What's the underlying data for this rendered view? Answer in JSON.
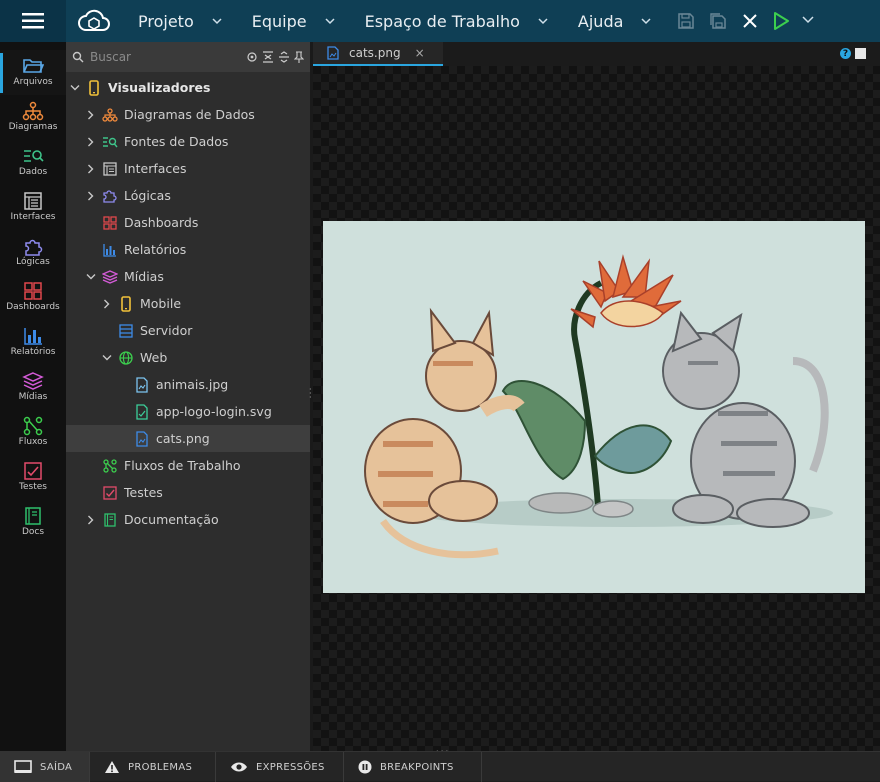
{
  "topbar": {
    "menus": [
      "Projeto",
      "Equipe",
      "Espaço de Trabalho",
      "Ajuda"
    ]
  },
  "activity": [
    {
      "label": "Arquivos",
      "icon": "folder-icon",
      "color": "#5aa7e6"
    },
    {
      "label": "Diagramas",
      "icon": "diagram-icon",
      "color": "#f08a3c"
    },
    {
      "label": "Dados",
      "icon": "data-search-icon",
      "color": "#3ec48a"
    },
    {
      "label": "Interfaces",
      "icon": "interface-icon",
      "color": "#c7c7c7"
    },
    {
      "label": "Lógicas",
      "icon": "puzzle-icon",
      "color": "#8f8cf0"
    },
    {
      "label": "Dashboards",
      "icon": "dashboard-icon",
      "color": "#e0474c"
    },
    {
      "label": "Relatórios",
      "icon": "bar-chart-icon",
      "color": "#3d8be8"
    },
    {
      "label": "Mídias",
      "icon": "layers-icon",
      "color": "#d55bd8"
    },
    {
      "label": "Fluxos",
      "icon": "flow-icon",
      "color": "#3ccf4e"
    },
    {
      "label": "Testes",
      "icon": "test-icon",
      "color": "#e24b6a"
    },
    {
      "label": "Docs",
      "icon": "book-icon",
      "color": "#2fbf6c"
    }
  ],
  "explorer": {
    "search_placeholder": "Buscar",
    "tree": [
      {
        "label": "Visualizadores",
        "level": 0,
        "caret": "down",
        "icon": "mobile-icon",
        "color": "#f2c23a",
        "bold": true
      },
      {
        "label": "Diagramas de Dados",
        "level": 1,
        "caret": "right",
        "icon": "diagram-icon",
        "color": "#f08a3c"
      },
      {
        "label": "Fontes de Dados",
        "level": 1,
        "caret": "right",
        "icon": "data-search-icon",
        "color": "#3ec48a"
      },
      {
        "label": "Interfaces",
        "level": 1,
        "caret": "right",
        "icon": "interface-icon",
        "color": "#c7c7c7"
      },
      {
        "label": "Lógicas",
        "level": 1,
        "caret": "right",
        "icon": "puzzle-icon",
        "color": "#8f8cf0"
      },
      {
        "label": "Dashboards",
        "level": 1,
        "caret": "",
        "icon": "dashboard-icon",
        "color": "#e0474c"
      },
      {
        "label": "Relatórios",
        "level": 1,
        "caret": "",
        "icon": "bar-chart-icon",
        "color": "#3d8be8"
      },
      {
        "label": "Mídias",
        "level": 1,
        "caret": "down",
        "icon": "layers-icon",
        "color": "#d55bd8"
      },
      {
        "label": "Mobile",
        "level": 2,
        "caret": "right",
        "icon": "mobile-icon",
        "color": "#f2c23a"
      },
      {
        "label": "Servidor",
        "level": 2,
        "caret": "",
        "icon": "server-icon",
        "color": "#3d8be8"
      },
      {
        "label": "Web",
        "level": 2,
        "caret": "down",
        "icon": "globe-icon",
        "color": "#3ccf4e"
      },
      {
        "label": "animais.jpg",
        "level": 3,
        "caret": "",
        "icon": "image-file-icon",
        "color": "#7cc4f0"
      },
      {
        "label": "app-logo-login.svg",
        "level": 3,
        "caret": "",
        "icon": "svg-file-icon",
        "color": "#3ccf9a"
      },
      {
        "label": "cats.png",
        "level": 3,
        "caret": "",
        "icon": "image-file-icon",
        "color": "#3d8be8",
        "selected": true
      },
      {
        "label": "Fluxos de Trabalho",
        "level": 1,
        "caret": "",
        "icon": "flow-icon",
        "color": "#3ccf4e"
      },
      {
        "label": "Testes",
        "level": 1,
        "caret": "",
        "icon": "test-icon",
        "color": "#e24b6a"
      },
      {
        "label": "Documentação",
        "level": 1,
        "caret": "right",
        "icon": "book-icon",
        "color": "#2fbf6c"
      }
    ]
  },
  "editor": {
    "tab_label": "cats.png",
    "tab_close": "×",
    "help": "?"
  },
  "bottom": [
    {
      "label": "SAÍDA",
      "icon": "output-icon",
      "active": true
    },
    {
      "label": "PROBLEMAS",
      "icon": "warning-icon"
    },
    {
      "label": "EXPRESSÕES",
      "icon": "eye-icon"
    },
    {
      "label": "BREAKPOINTS",
      "icon": "pause-icon"
    }
  ],
  "colors": {
    "accent": "#2aa6e0",
    "topbar": "#0f3f55",
    "run": "#3ccf4e"
  }
}
